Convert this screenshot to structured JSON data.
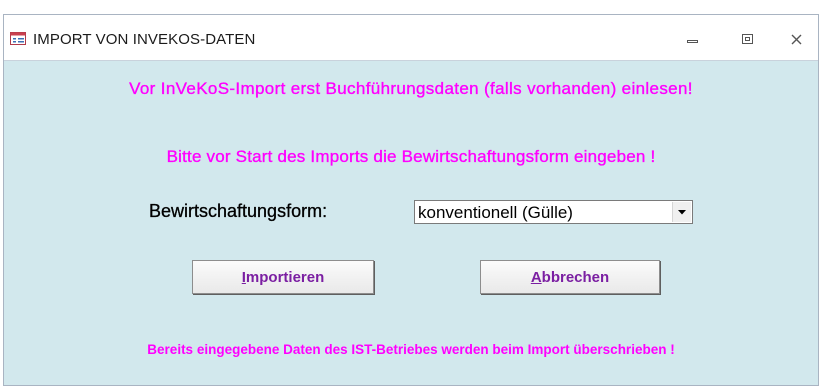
{
  "window": {
    "title": "IMPORT VON INVEKOS-DATEN",
    "icon": "form-icon",
    "controls": [
      "minimize-icon",
      "restore-icon",
      "close-icon"
    ]
  },
  "messages": {
    "top": "Vor InVeKoS-Import erst Buchführungsdaten (falls vorhanden) einlesen!",
    "instruction": "Bitte vor Start des Imports die Bewirtschaftungsform eingeben !",
    "warning": "Bereits eingegebene Daten des IST-Betriebes werden beim Import überschrieben !"
  },
  "form": {
    "label": "Bewirtschaftungsform:",
    "selected_value": "konventionell (Gülle)"
  },
  "buttons": {
    "import": {
      "accel": "I",
      "rest": "mportieren"
    },
    "cancel": {
      "accel": "A",
      "rest": "bbrechen"
    }
  },
  "colors": {
    "message": "#ff00ff",
    "button_text": "#7b1fa2",
    "client_background": "#d2e8ed"
  }
}
